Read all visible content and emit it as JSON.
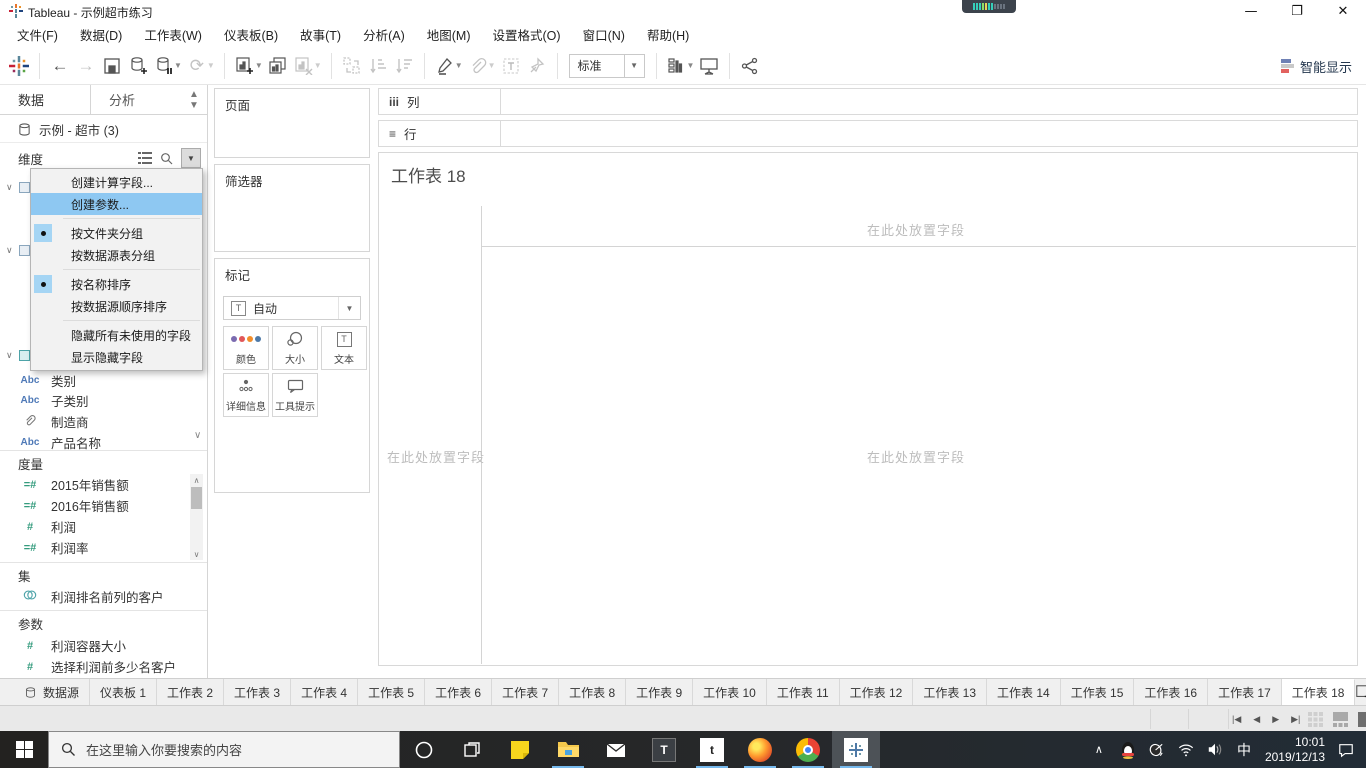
{
  "titlebar": {
    "title": "Tableau - 示例超市练习"
  },
  "menubar": {
    "items": [
      {
        "label": "文件(F)"
      },
      {
        "label": "数据(D)"
      },
      {
        "label": "工作表(W)"
      },
      {
        "label": "仪表板(B)"
      },
      {
        "label": "故事(T)"
      },
      {
        "label": "分析(A)"
      },
      {
        "label": "地图(M)"
      },
      {
        "label": "设置格式(O)"
      },
      {
        "label": "窗口(N)"
      },
      {
        "label": "帮助(H)"
      }
    ]
  },
  "toolbar": {
    "fit_label": "标准",
    "show_me_label": "智能显示"
  },
  "sidebar": {
    "tabs": {
      "data": "数据",
      "analytics": "分析"
    },
    "datasource": "示例 - 超市 (3)",
    "dimensions": {
      "header": "维度",
      "fields": [
        {
          "icon": "abc",
          "label": "类别"
        },
        {
          "icon": "abc",
          "label": "子类别"
        },
        {
          "icon": "paperclip",
          "label": "制造商"
        },
        {
          "icon": "abc",
          "label": "产品名称"
        }
      ]
    },
    "measures": {
      "header": "度量",
      "fields": [
        {
          "icon": "calc-number",
          "label": "2015年销售额"
        },
        {
          "icon": "calc-number",
          "label": "2016年销售额"
        },
        {
          "icon": "number",
          "label": "利润"
        },
        {
          "icon": "calc-number",
          "label": "利润率"
        }
      ]
    },
    "sets": {
      "header": "集",
      "fields": [
        {
          "icon": "set",
          "label": "利润排名前列的客户"
        }
      ]
    },
    "parameters": {
      "header": "参数",
      "fields": [
        {
          "icon": "number",
          "label": "利润容器大小"
        },
        {
          "icon": "number",
          "label": "选择利润前多少名客户"
        }
      ]
    }
  },
  "context_menu": {
    "items": [
      {
        "label": "创建计算字段...",
        "highlighted": false
      },
      {
        "label": "创建参数...",
        "highlighted": true
      },
      {
        "label": "按文件夹分组",
        "checked": true
      },
      {
        "label": "按数据源表分组",
        "checked": false
      },
      {
        "label": "按名称排序",
        "checked": true
      },
      {
        "label": "按数据源顺序排序",
        "checked": false
      },
      {
        "label": "隐藏所有未使用的字段",
        "checked": false
      },
      {
        "label": "显示隐藏字段",
        "checked": false
      }
    ]
  },
  "cards": {
    "pages": "页面",
    "filters": "筛选器",
    "marks": {
      "header": "标记",
      "mark_type": "自动",
      "buttons": [
        {
          "label": "颜色"
        },
        {
          "label": "大小"
        },
        {
          "label": "文本"
        },
        {
          "label": "详细信息"
        },
        {
          "label": "工具提示"
        }
      ]
    }
  },
  "shelves": {
    "columns": "列",
    "rows": "行"
  },
  "canvas": {
    "title": "工作表 18",
    "drop_hint": "在此处放置字段"
  },
  "sheet_tabs": {
    "datasource": "数据源",
    "tabs": [
      "仪表板 1",
      "工作表 2",
      "工作表 3",
      "工作表 4",
      "工作表 5",
      "工作表 6",
      "工作表 7",
      "工作表 8",
      "工作表 9",
      "工作表 10",
      "工作表 11",
      "工作表 12",
      "工作表 13",
      "工作表 14",
      "工作表 15",
      "工作表 16",
      "工作表 17",
      "工作表 18"
    ],
    "active": "工作表 18"
  },
  "taskbar": {
    "search_placeholder": "在这里输入你要搜索的内容",
    "input_indicator": "中",
    "time": "10:01",
    "date": "2019/12/13"
  },
  "colors": {
    "menu_highlight": "#8ec8f2",
    "dimension_blue": "#4e79b7",
    "measure_green": "#359c7e"
  }
}
